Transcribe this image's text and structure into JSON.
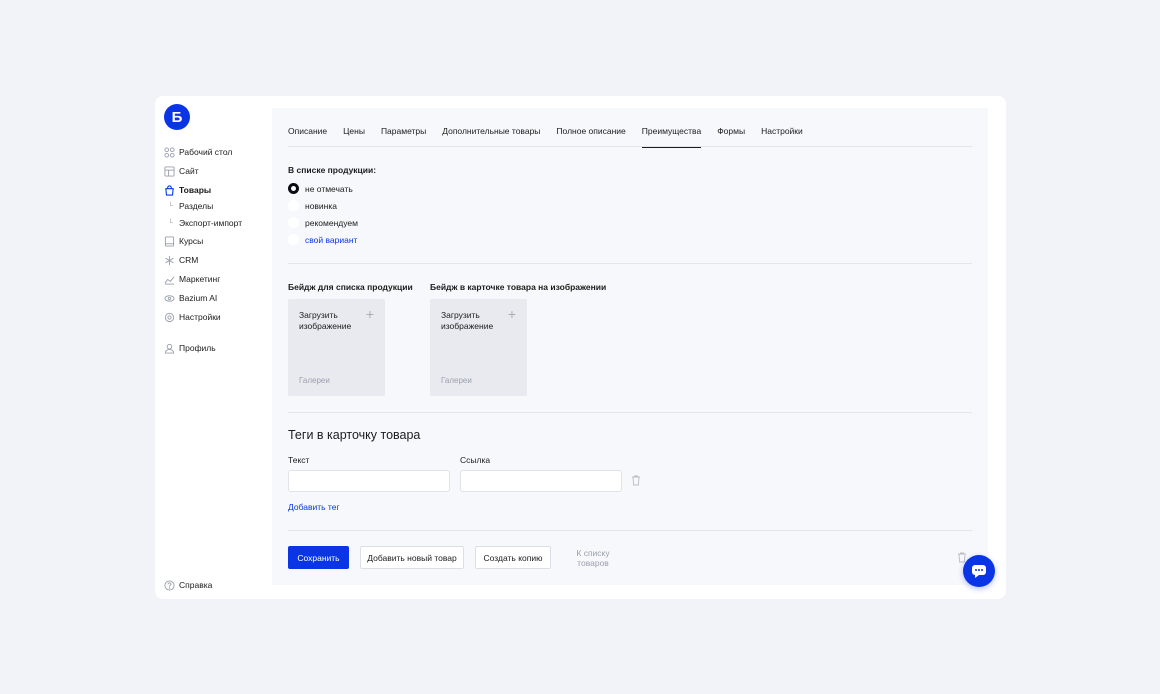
{
  "brand": {
    "logo_letter": "Б",
    "accent": "#0a35e6"
  },
  "sidebar": {
    "items": [
      {
        "label": "Рабочий стол",
        "icon": "grid-icon"
      },
      {
        "label": "Сайт",
        "icon": "layout-icon"
      },
      {
        "label": "Товары",
        "icon": "bag-icon"
      },
      {
        "label": "Курсы",
        "icon": "book-icon"
      },
      {
        "label": "CRM",
        "icon": "asterisk-icon"
      },
      {
        "label": "Маркетинг",
        "icon": "chart-icon"
      },
      {
        "label": "Bazium AI",
        "icon": "ai-icon"
      },
      {
        "label": "Настройки",
        "icon": "gear-icon"
      }
    ],
    "subitems": [
      {
        "label": "Разделы"
      },
      {
        "label": "Экспорт-импорт"
      }
    ],
    "profile": {
      "label": "Профиль",
      "icon": "user-icon"
    },
    "help": {
      "label": "Справка",
      "icon": "help-icon"
    }
  },
  "tabs": [
    {
      "label": "Описание"
    },
    {
      "label": "Цены"
    },
    {
      "label": "Параметры"
    },
    {
      "label": "Дополнительные товары"
    },
    {
      "label": "Полное описание"
    },
    {
      "label": "Преимущества",
      "active": true
    },
    {
      "label": "Формы"
    },
    {
      "label": "Настройки"
    }
  ],
  "product_list": {
    "title": "В списке продукции:",
    "options": [
      {
        "label": "не отмечать",
        "selected": true
      },
      {
        "label": "новинка"
      },
      {
        "label": "рекомендуем"
      },
      {
        "label": "свой вариант"
      }
    ]
  },
  "badges": {
    "list_title": "Бейдж для списка продукции",
    "card_title": "Бейдж в карточке товара на изображении",
    "upload_label": "Загрузить изображение",
    "gallery_label": "Галереи"
  },
  "tags": {
    "title": "Теги в карточку товара",
    "text_label": "Текст",
    "link_label": "Ссылка",
    "add_label": "Добавить тег"
  },
  "actions": {
    "save": "Сохранить",
    "add_new": "Добавить новый товар",
    "copy": "Создать копию",
    "back": "К списку товаров"
  }
}
